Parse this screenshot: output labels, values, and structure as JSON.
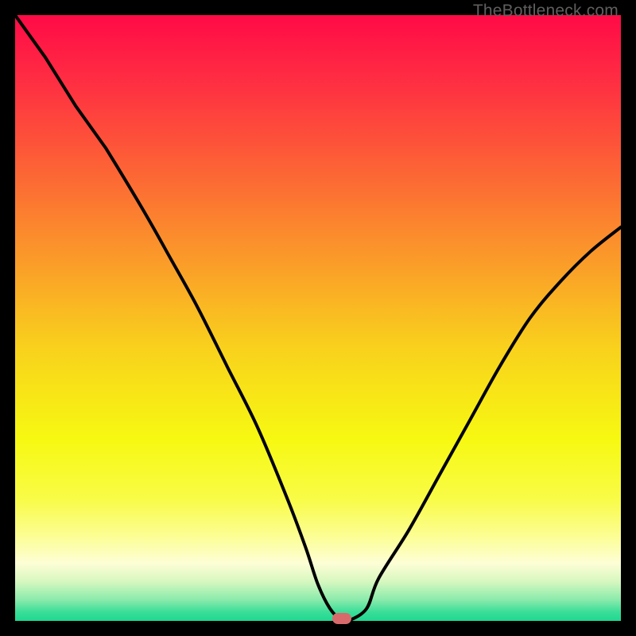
{
  "watermark": "TheBottleneck.com",
  "colors": {
    "gradient_stops": [
      {
        "offset": 0.0,
        "color": "#ff0b47"
      },
      {
        "offset": 0.1,
        "color": "#ff2b43"
      },
      {
        "offset": 0.25,
        "color": "#fd6236"
      },
      {
        "offset": 0.4,
        "color": "#fb9a2a"
      },
      {
        "offset": 0.55,
        "color": "#f9d21d"
      },
      {
        "offset": 0.7,
        "color": "#f7f912"
      },
      {
        "offset": 0.8,
        "color": "#f9fc48"
      },
      {
        "offset": 0.86,
        "color": "#fcfe94"
      },
      {
        "offset": 0.905,
        "color": "#fefed6"
      },
      {
        "offset": 0.935,
        "color": "#d7f8c0"
      },
      {
        "offset": 0.965,
        "color": "#8bebac"
      },
      {
        "offset": 0.985,
        "color": "#3cde99"
      },
      {
        "offset": 1.0,
        "color": "#1fd991"
      }
    ],
    "curve": "#000000",
    "marker": "#d96a6b",
    "frame": "#000000"
  },
  "chart_data": {
    "type": "line",
    "title": "",
    "xlabel": "",
    "ylabel": "",
    "xlim": [
      0,
      100
    ],
    "ylim": [
      0,
      100
    ],
    "grid": false,
    "legend": false,
    "series": [
      {
        "name": "bottleneck-curve",
        "x": [
          0,
          5,
          10,
          15,
          20,
          25,
          30,
          35,
          40,
          45,
          48,
          50,
          52,
          54,
          55,
          58,
          60,
          65,
          70,
          75,
          80,
          85,
          90,
          95,
          100
        ],
        "y": [
          100,
          93,
          85,
          78,
          70,
          61,
          52,
          42,
          32,
          20,
          12,
          6,
          2,
          0,
          0,
          2,
          7,
          15,
          24,
          33,
          42,
          50,
          56,
          61,
          65
        ]
      }
    ],
    "marker": {
      "x": 54,
      "y": 0
    },
    "kink": {
      "x": 15,
      "y": 78
    }
  }
}
